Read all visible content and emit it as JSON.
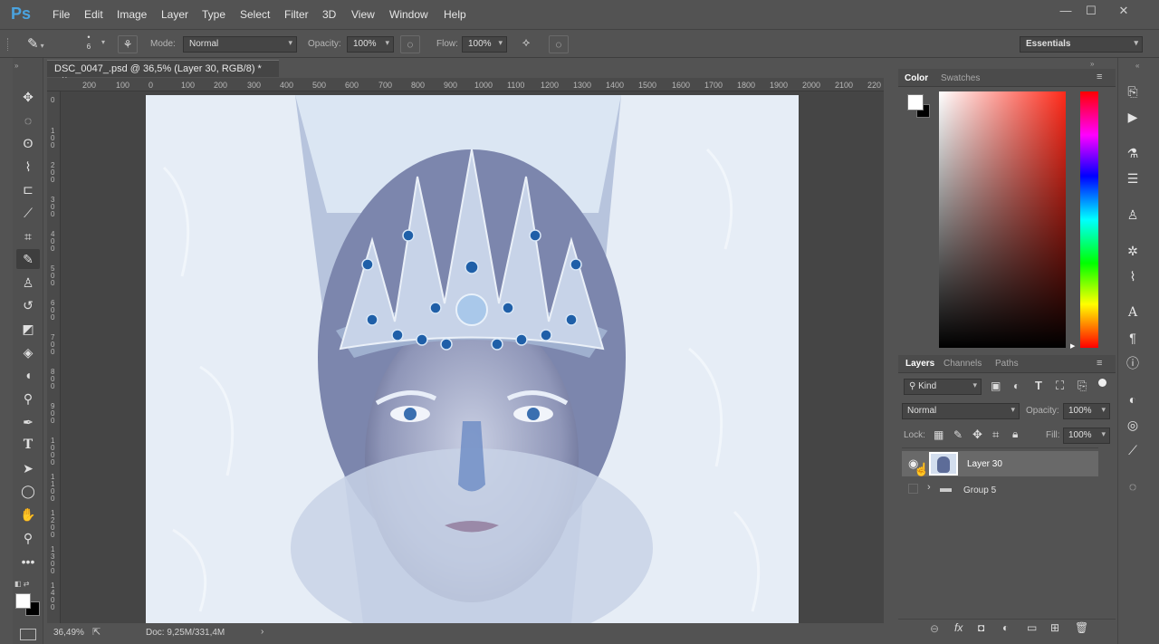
{
  "app": {
    "logo": "Ps"
  },
  "menu": [
    "File",
    "Edit",
    "Image",
    "Layer",
    "Type",
    "Select",
    "Filter",
    "3D",
    "View",
    "Window",
    "Help"
  ],
  "window_controls": {
    "minimize": "—",
    "maximize": "☐",
    "close": "✕"
  },
  "options": {
    "brush_size": "6",
    "mode_label": "Mode:",
    "mode_value": "Normal",
    "opacity_label": "Opacity:",
    "opacity_value": "100%",
    "flow_label": "Flow:",
    "flow_value": "100%",
    "workspace": "Essentials"
  },
  "document": {
    "tab_title": "DSC_0047_.psd @ 36,5% (Layer 30, RGB/8) *",
    "close": "×",
    "ruler_top": [
      "200",
      "100",
      "0",
      "100",
      "200",
      "300",
      "400",
      "500",
      "600",
      "700",
      "800",
      "900",
      "1000",
      "1100",
      "1200",
      "1300",
      "1400",
      "1500",
      "1600",
      "1700",
      "1800",
      "1900",
      "2000",
      "2100",
      "220"
    ],
    "ruler_left": [
      "0",
      "1\n0\n0",
      "2\n0\n0",
      "3\n0\n0",
      "4\n0\n0",
      "5\n0\n0",
      "6\n0\n0",
      "7\n0\n0",
      "8\n0\n0",
      "9\n0\n0",
      "1\n0\n0\n0",
      "1\n1\n0\n0",
      "1\n2\n0\n0",
      "1\n3\n0\n0",
      "1\n4\n0\n0"
    ],
    "zoom": "36,49%",
    "doc_size": "Doc: 9,25M/331,4M"
  },
  "color_panel": {
    "tabs": [
      "Color",
      "Swatches"
    ],
    "active": "Color"
  },
  "layers_panel": {
    "tabs": [
      "Layers",
      "Channels",
      "Paths"
    ],
    "active": "Layers",
    "kind_filter": "Kind",
    "blend_mode": "Normal",
    "opacity_label": "Opacity:",
    "opacity_value": "100%",
    "lock_label": "Lock:",
    "fill_label": "Fill:",
    "fill_value": "100%",
    "layers": [
      {
        "name": "Layer 30",
        "selected": true,
        "visible": true
      },
      {
        "name": "Group 5",
        "selected": false,
        "visible": false
      }
    ]
  },
  "colors": {
    "accent": "#4aa3df",
    "panel": "#535353",
    "selected_row": "#696969"
  }
}
